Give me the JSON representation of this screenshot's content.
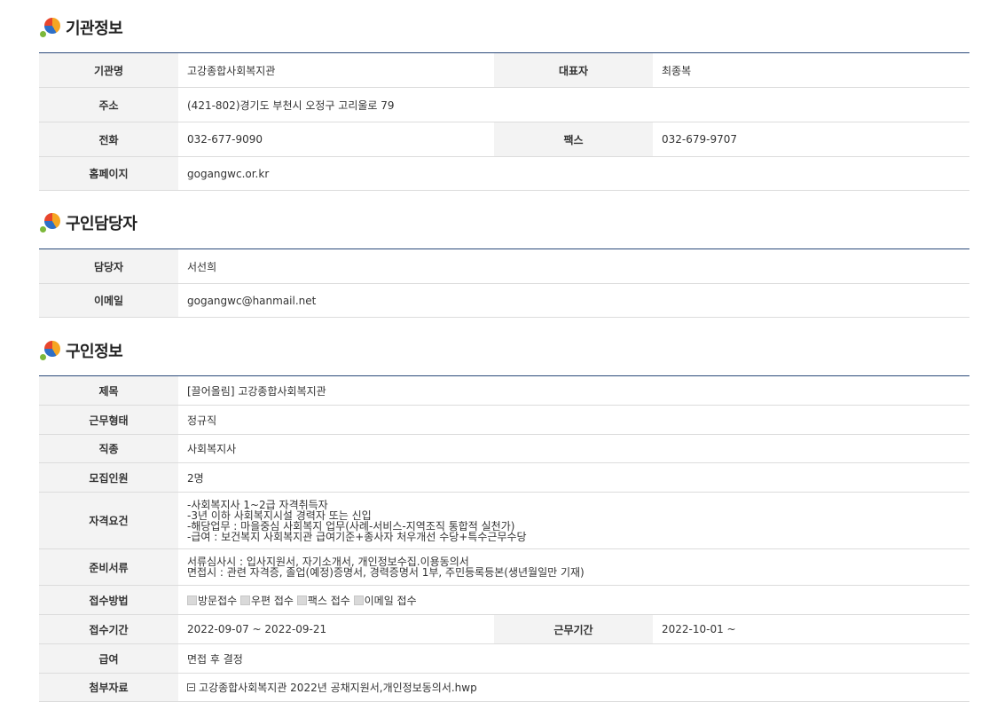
{
  "sections": [
    {
      "title": "기관정보"
    },
    {
      "title": "구인담당자"
    },
    {
      "title": "구인정보"
    }
  ],
  "org": {
    "name_label": "기관명",
    "name": "고강종합사회복지관",
    "rep_label": "대표자",
    "rep": "최종복",
    "addr_label": "주소",
    "addr": "(421-802)경기도 부천시 오정구 고리울로 79",
    "tel_label": "전화",
    "tel": "032-677-9090",
    "fax_label": "팩스",
    "fax": "032-679-9707",
    "home_label": "홈페이지",
    "home": "gogangwc.or.kr"
  },
  "contact": {
    "person_label": "담당자",
    "person": "서선희",
    "email_label": "이메일",
    "email": "gogangwc@hanmail.net"
  },
  "job": {
    "title_label": "제목",
    "title": "[끌어올림] 고강종합사회복지관",
    "type_label": "근무형태",
    "type": "정규직",
    "kind_label": "직종",
    "kind": "사회복지사",
    "count_label": "모집인원",
    "count": "2명",
    "req_label": "자격요건",
    "req": [
      "-사회복지사 1~2급 자격취득자",
      "-3년 이하 사회복지시설 경력자 또는 신입",
      "-해당업무 : 마을중심 사회복지 업무(사례-서비스-지역조직 통합적 실천가)",
      "-급여 : 보건복지 사회복지관 급여기준+종사자 처우개선 수당+특수근무수당"
    ],
    "docs_label": "준비서류",
    "docs": [
      "서류심사시 : 입사지원서, 자기소개서, 개인정보수집.이용동의서",
      "면접시 : 관련 자격증, 졸업(예정)증명서, 경력증명서 1부, 주민등록등본(생년월일만 기재)"
    ],
    "method_label": "접수방법",
    "methods": [
      "방문접수",
      "우편 접수",
      "팩스 접수",
      "이메일 접수"
    ],
    "period_label": "접수기간",
    "period": "2022-09-07 ~ 2022-09-21",
    "workperiod_label": "근무기간",
    "workperiod": "2022-10-01 ~",
    "pay_label": "급여",
    "pay": "면접 후 결정",
    "attach_label": "첨부자료",
    "attach": "고강종합사회복지관 2022년 공채지원서,개인정보동의서.hwp"
  }
}
